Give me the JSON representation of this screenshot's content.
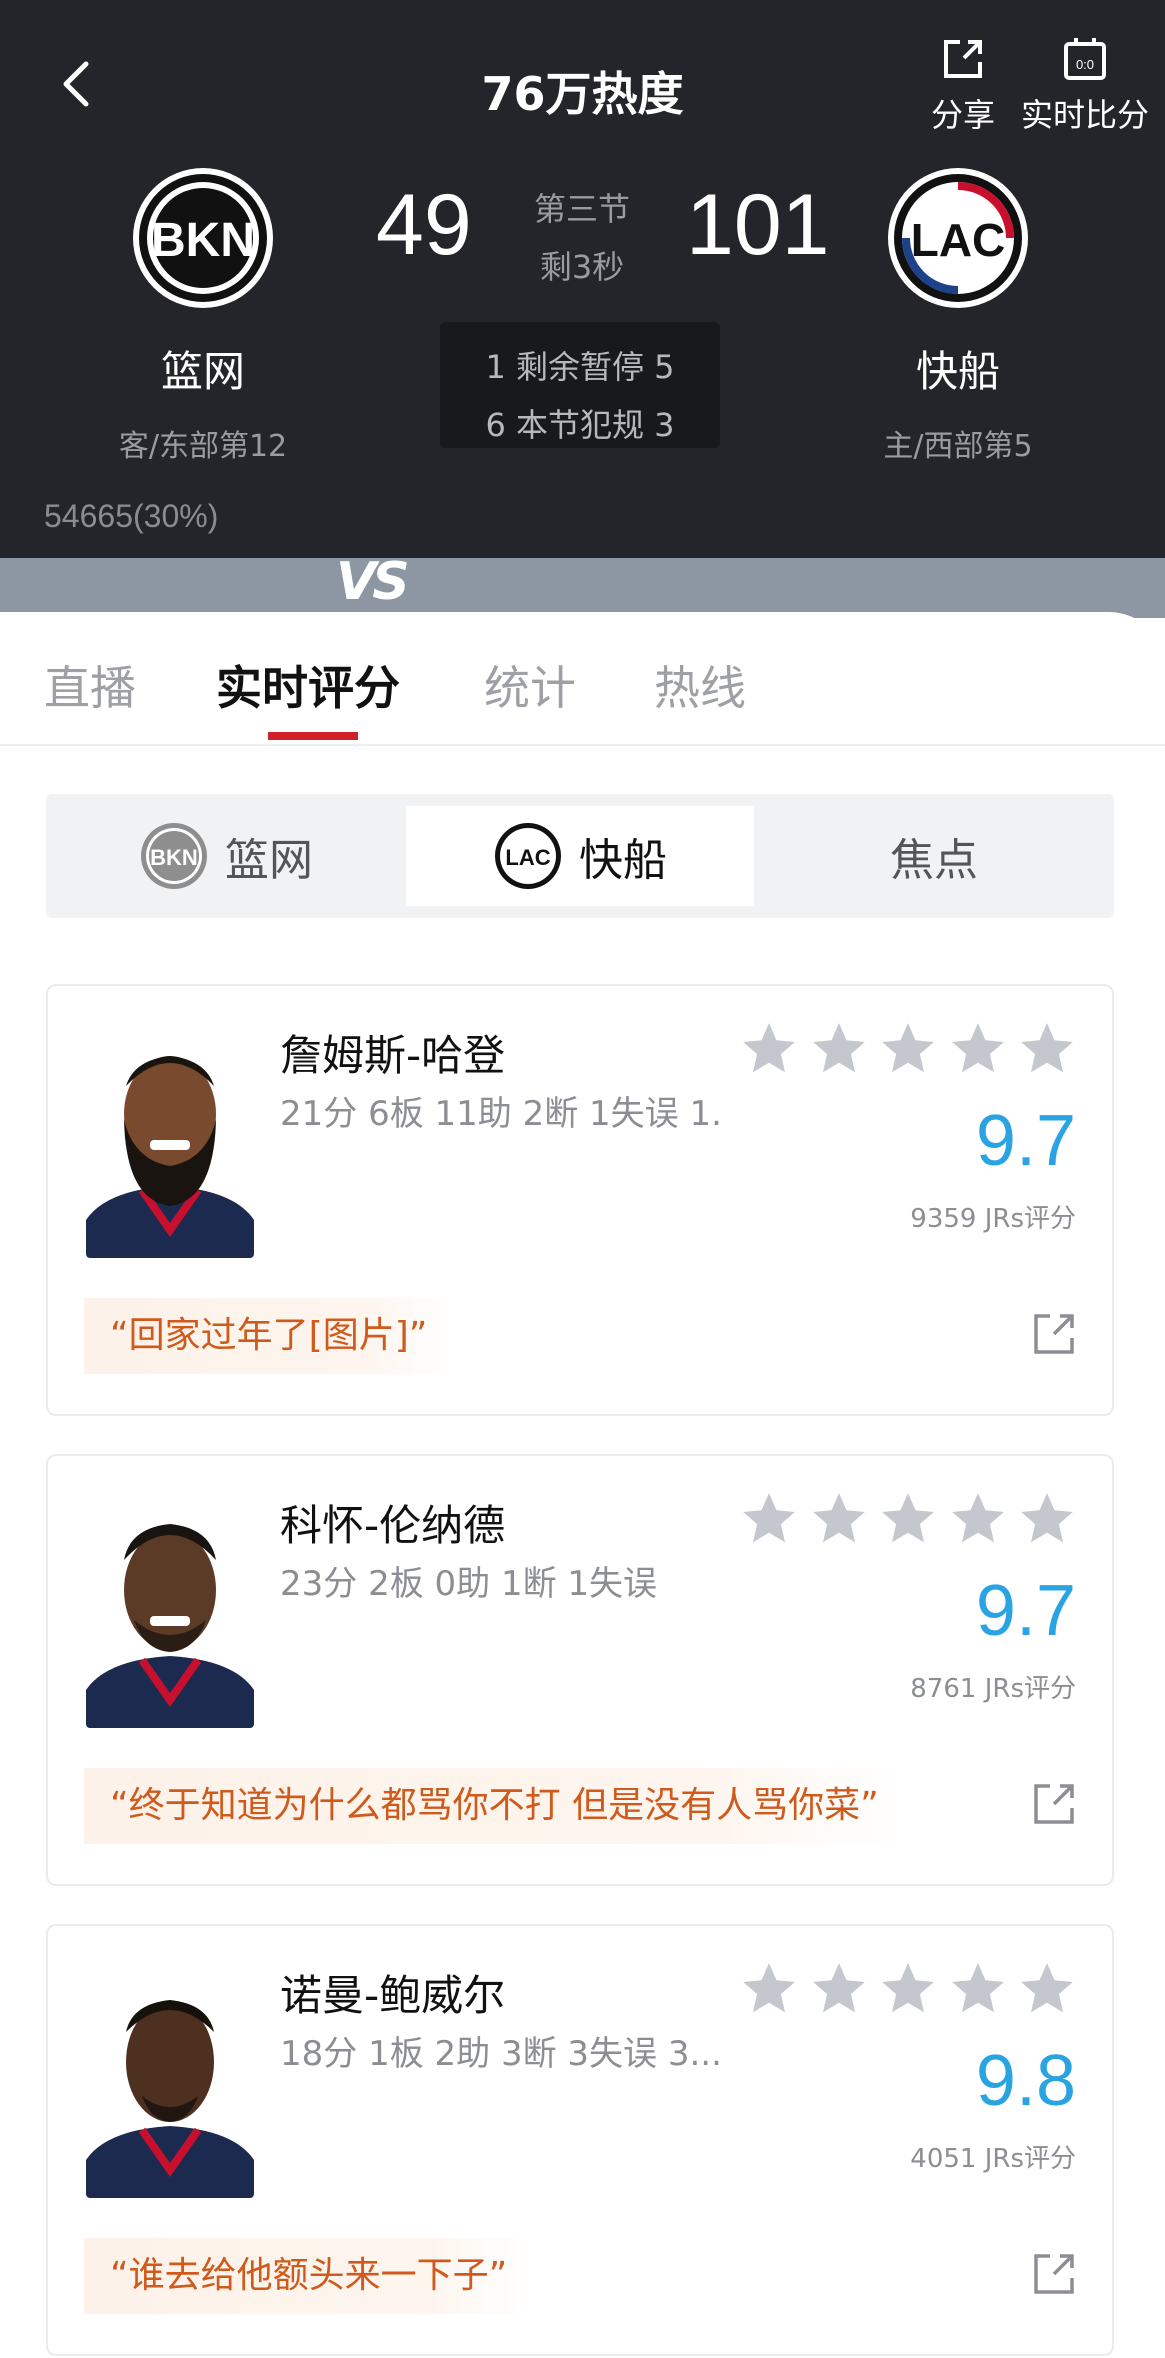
{
  "header": {
    "heat_title": "76万热度",
    "share_label": "分享",
    "compare_label": "实时比分",
    "compare_icon_text": "0:0",
    "away": {
      "logo_text": "BKN",
      "name": "篮网",
      "rank": "客/东部第12",
      "score": "49"
    },
    "home": {
      "logo_text": "LAC",
      "name": "快船",
      "rank": "主/西部第5",
      "score": "101"
    },
    "period": "第三节",
    "time_left": "剩3秒",
    "timeouts_line": "1 剩余暂停 5",
    "fouls_line": "6 本节犯规 3",
    "support_count": "54665(30%)",
    "vs_text": "VS"
  },
  "tabs": {
    "items": [
      {
        "label": "直播"
      },
      {
        "label": "实时评分"
      },
      {
        "label": "统计"
      },
      {
        "label": "热线"
      }
    ],
    "active": "实时评分"
  },
  "segments": {
    "away_label": "篮网",
    "home_label": "快船",
    "focus_label": "焦点",
    "active": "快船"
  },
  "players": [
    {
      "name": "詹姆斯-哈登",
      "stats": "21分 6板 11助 2断 1失误 1...",
      "rating": "9.7",
      "votes": "9359 JRs评分",
      "quote": "“回家过年了[图片]”"
    },
    {
      "name": "科怀-伦纳德",
      "stats": "23分 2板 0助 1断 1失误",
      "rating": "9.7",
      "votes": "8761 JRs评分",
      "quote": "“终于知道为什么都骂你不打 但是没有人骂你菜”"
    },
    {
      "name": "诺曼-鲍威尔",
      "stats": "18分 1板 2助 3断 3失误 3...",
      "rating": "9.8",
      "votes": "4051 JRs评分",
      "quote": "“谁去给他额头来一下子”"
    }
  ],
  "colors": {
    "header_bg": "#24252a",
    "accent_red": "#d2202a",
    "rating_blue": "#2aa3e3",
    "quote_orange": "#d05a1b",
    "star_gray": "#c4c7ce"
  }
}
